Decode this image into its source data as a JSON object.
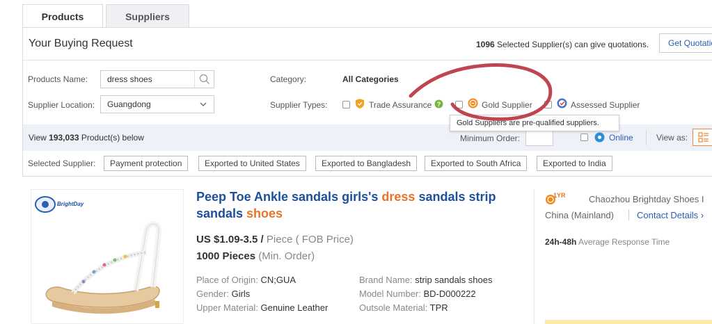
{
  "tabs": [
    {
      "label": "Products",
      "active": true
    },
    {
      "label": "Suppliers",
      "active": false
    }
  ],
  "request": {
    "title": "Your Buying Request",
    "supplier_count": "1096",
    "supplier_count_suffix": " Selected Supplier(s) can give quotations.",
    "quote_button": "Get Quotations"
  },
  "filters": {
    "products_name_label": "Products Name:",
    "products_name_value": "dress shoes",
    "supplier_location_label": "Supplier Location:",
    "supplier_location_value": "Guangdong",
    "category_label": "Category:",
    "category_value": "All Categories",
    "supplier_types_label": "Supplier Types:",
    "supplier_types": [
      {
        "label": "Trade Assurance",
        "icon": "shield-icon"
      },
      {
        "label": "Gold Supplier",
        "icon": "gold-medal-icon"
      },
      {
        "label": "Assessed Supplier",
        "icon": "assessed-badge-icon"
      }
    ],
    "tooltip": "Gold Suppliers are pre-qualified suppliers."
  },
  "results_bar": {
    "view_prefix": "View ",
    "product_count": "193,033",
    "view_suffix": " Product(s) below",
    "min_order_label": "Minimum Order:",
    "online_label": "Online",
    "view_as_label": "View as:"
  },
  "selected_supplier": {
    "label": "Selected Supplier:",
    "chips": [
      "Payment protection",
      "Exported to United States",
      "Exported to Bangladesh",
      "Exported to South Africa",
      "Exported to India"
    ]
  },
  "product": {
    "logo_text": "BrightDay",
    "title_part1": "Peep Toe Ankle sandals girls's ",
    "title_hl1": "dress",
    "title_part2": " sandals strip sandals ",
    "title_hl2": "shoes",
    "price": "US $1.09-3.5 /",
    "price_unit": " Piece ( FOB Price)",
    "min_order": "1000 Pieces",
    "min_order_suffix": " (Min. Order)",
    "attributes": [
      {
        "label": "Place of Origin: ",
        "value": "CN;GUA"
      },
      {
        "label": "Gender: ",
        "value": "Girls"
      },
      {
        "label": "Upper Material: ",
        "value": "Genuine Leather"
      },
      {
        "label": "Brand Name: ",
        "value": "strip sandals shoes"
      },
      {
        "label": "Model Number: ",
        "value": "BD-D000222"
      },
      {
        "label": "Outsole Material: ",
        "value": "TPR"
      }
    ]
  },
  "supplier": {
    "years": "1YR",
    "company": "Chaozhou Brightday Shoes I",
    "country": "China (Mainland)",
    "contact": "Contact Details ›",
    "response_time": "24h-48h",
    "response_label": " Average Response Time"
  },
  "colors": {
    "link": "#1c4f9c",
    "highlight": "#e8742a",
    "annotation": "#b8323d"
  }
}
